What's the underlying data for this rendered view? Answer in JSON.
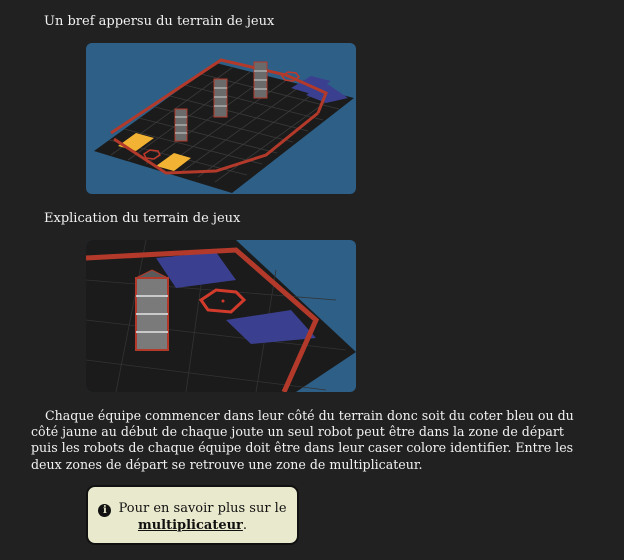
{
  "sections": {
    "overview_heading": "Un bref appersu du terrain de jeux",
    "explanation_heading": "Explication du terrain de jeux"
  },
  "description": "Chaque équipe commencer dans leur côté du terrain donc soit du coter bleu ou du côté jaune au début de chaque joute un seul robot peut être dans la zone de départ puis les robots de chaque équipe doit être dans leur caser colore identifier. Entre les deux zones de départ se retrouve une zone de multiplicateur.",
  "info_box": {
    "icon": "info-icon",
    "text": "Pour en savoir plus sur le",
    "link_label": "multiplicateur",
    "suffix": "."
  },
  "colors": {
    "background": "#222121",
    "image_backdrop": "#2d5f87",
    "board": "#1b1b1b",
    "border_red": "#b33a2a",
    "blue_zone": "#3b3f8f",
    "yellow_zone": "#f2b233",
    "info_box_bg": "#e9e9cd"
  }
}
